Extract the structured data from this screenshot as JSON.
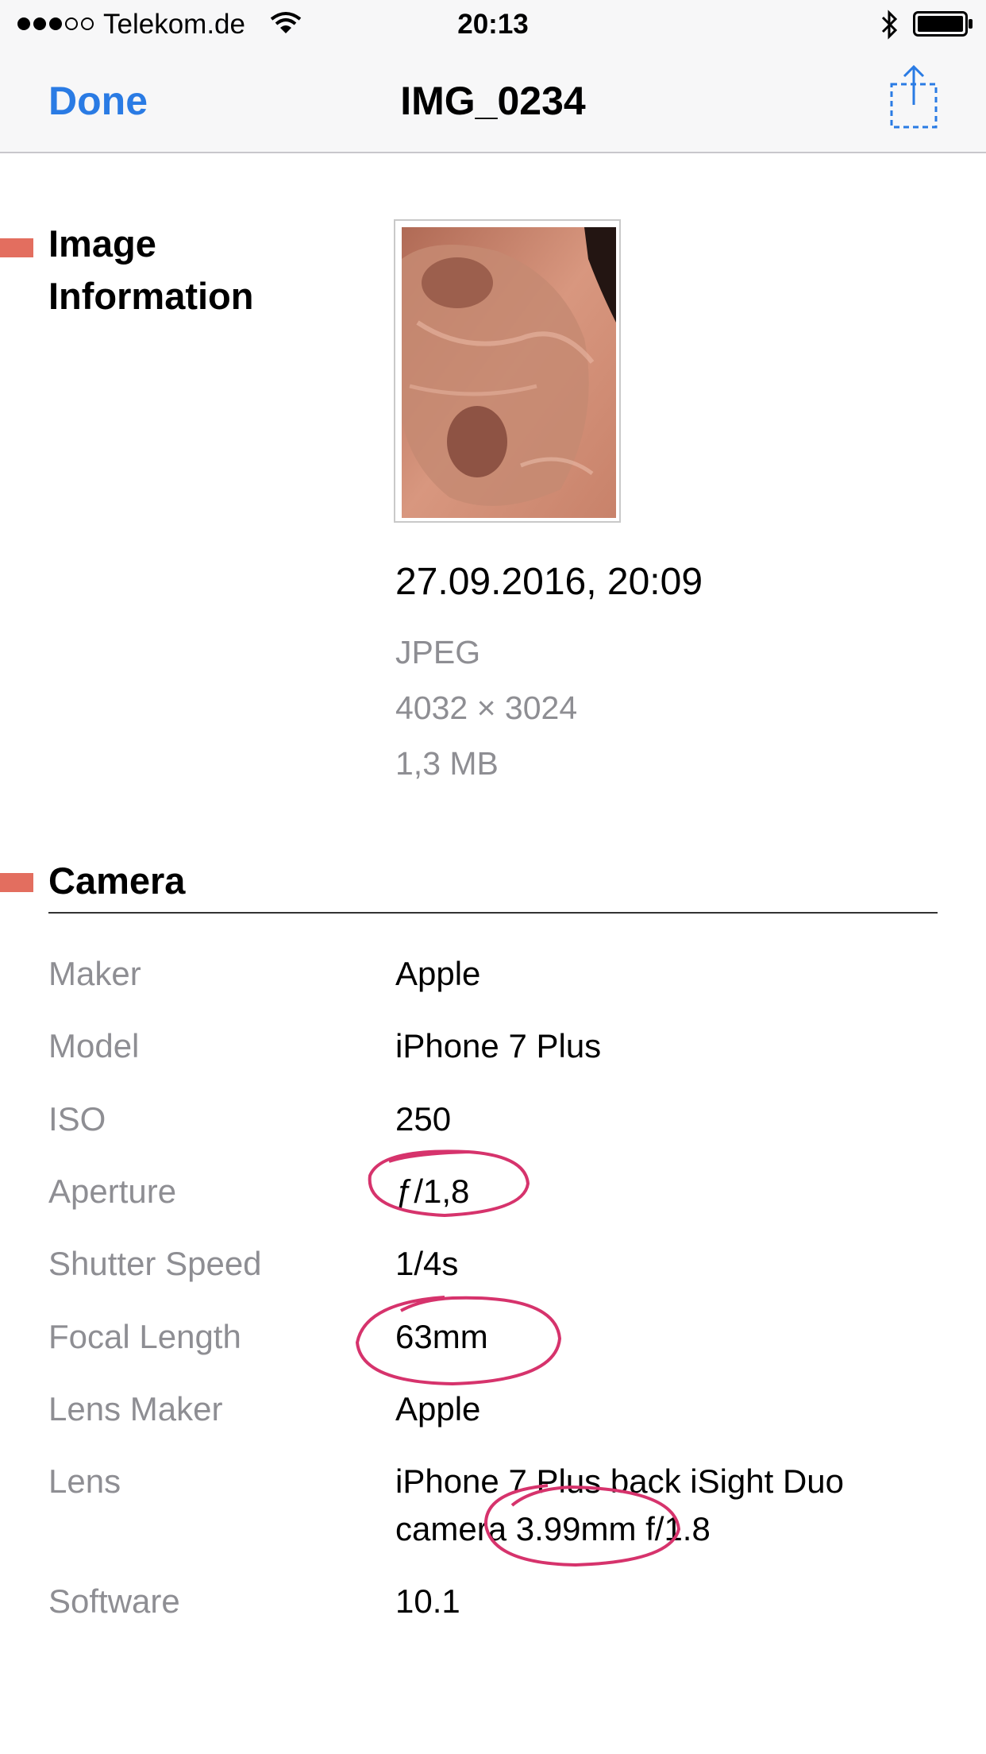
{
  "status_bar": {
    "carrier": "Telekom.de",
    "time": "20:13"
  },
  "nav": {
    "done_label": "Done",
    "title": "IMG_0234"
  },
  "image_info": {
    "heading": "Image Information",
    "datetime": "27.09.2016, 20:09",
    "format": "JPEG",
    "dimensions": "4032 × 3024",
    "file_size": "1,3 MB"
  },
  "camera": {
    "heading": "Camera",
    "rows": [
      {
        "label": "Maker",
        "value": "Apple"
      },
      {
        "label": "Model",
        "value": "iPhone 7 Plus"
      },
      {
        "label": "ISO",
        "value": "250"
      },
      {
        "label": "Aperture",
        "value": "ƒ/1,8"
      },
      {
        "label": "Shutter Speed",
        "value": "1/4s"
      },
      {
        "label": "Focal Length",
        "value": "63mm"
      },
      {
        "label": "Lens Maker",
        "value": "Apple"
      },
      {
        "label": "Lens",
        "value": "iPhone 7 Plus back iSight Duo camera 3.99mm f/1.8"
      },
      {
        "label": "Software",
        "value": "10.1"
      }
    ]
  },
  "colors": {
    "accent": "#2a7be4",
    "section_marker": "#e36e5f",
    "annotation": "#d6336c"
  }
}
